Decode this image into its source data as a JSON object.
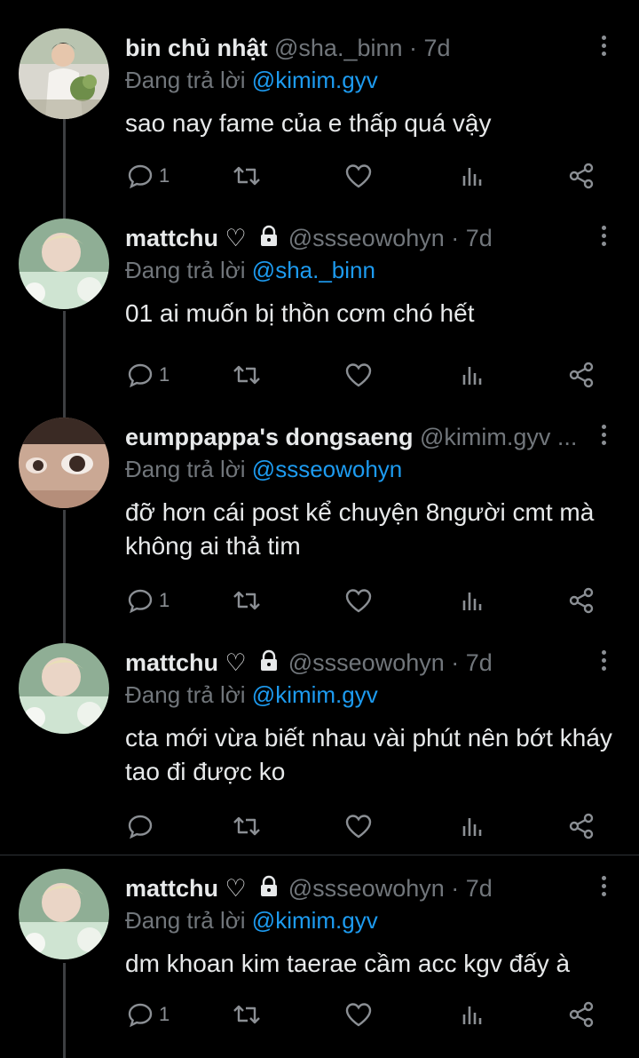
{
  "tweets": [
    {
      "name": "bin chủ nhật",
      "handle": "@sha._binn · 7d",
      "reply_prefix": "Đang trả lời",
      "reply_to": "@kimim.gyv",
      "text": "sao nay fame của e thấp quá vậy",
      "reply_count": "1",
      "has_badges": false
    },
    {
      "name": "mattchu ♡",
      "handle": "@ssseowohyn · 7d",
      "reply_prefix": "Đang trả lời",
      "reply_to": "@sha._binn",
      "text": "01 ai muốn bị thồn cơm chó hết",
      "reply_count": "1",
      "has_badges": true
    },
    {
      "name": "eumppappa's dongsaeng",
      "handle": "@kimim.gyv ...",
      "reply_prefix": "Đang trả lời",
      "reply_to": "@ssseowohyn",
      "text": "đỡ hơn cái post kể chuyện 8người cmt mà không ai thả tim",
      "reply_count": "1",
      "has_badges": false
    },
    {
      "name": "mattchu ♡",
      "handle": "@ssseowohyn · 7d",
      "reply_prefix": "Đang trả lời",
      "reply_to": "@kimim.gyv",
      "text": "cta mới vừa biết nhau vài phút nên bớt kháy tao đi được ko",
      "reply_count": "",
      "has_badges": true
    },
    {
      "name": "mattchu ♡",
      "handle": "@ssseowohyn · 7d",
      "reply_prefix": "Đang trả lời",
      "reply_to": "@kimim.gyv",
      "text": "dm khoan kim taerae cầm acc kgv đấy à",
      "reply_count": "1",
      "has_badges": true
    }
  ],
  "icons": {
    "reply": "reply-icon",
    "retweet": "retweet-icon",
    "like": "heart-icon",
    "views": "views-icon",
    "share": "share-icon",
    "menu": "more-vertical-icon",
    "lock": "lock-icon"
  },
  "colors": {
    "background": "#000000",
    "text": "#e7e9ea",
    "secondary": "#71767b",
    "link": "#1d9bf0",
    "thread_line": "#3d3f42"
  }
}
